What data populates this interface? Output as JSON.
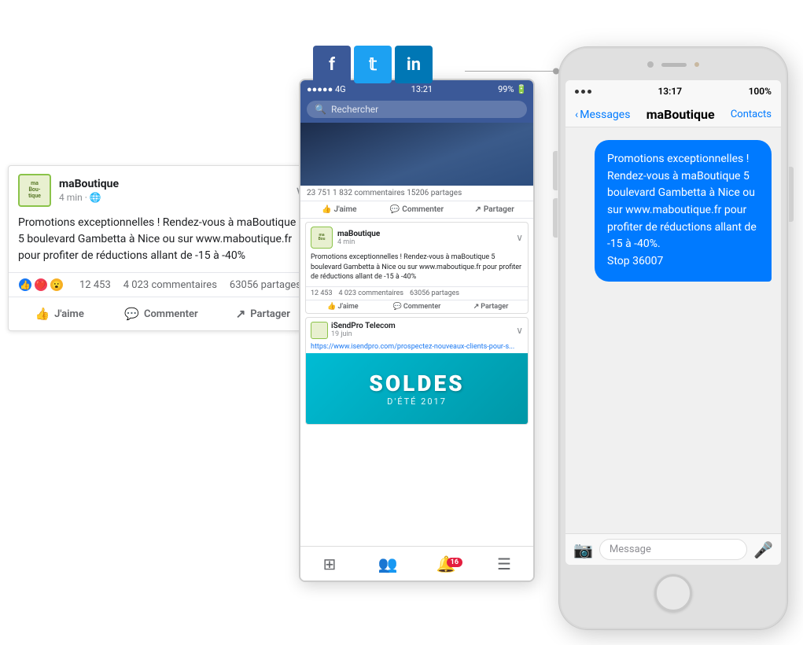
{
  "social": {
    "fb_letter": "f",
    "tw_letter": "t",
    "li_letter": "in"
  },
  "fb_card_left": {
    "brand_name": "maBoutique",
    "brand_lines": [
      "ma",
      "Bou-",
      "tique"
    ],
    "time": "4 min",
    "body": "Promotions exceptionnelles ! Rendez-vous à maBoutique 5 boulevard Gambetta à Nice ou sur www.maboutique.fr pour profiter de réductions allant de -15 à -40%",
    "likes_count": "12 453",
    "comments": "4 023 commentaires",
    "shares": "63056 partages",
    "jaime": "J'aime",
    "commenter": "Commenter",
    "partager": "Partager"
  },
  "phone_fb": {
    "status_left": "●●●●● 4G",
    "status_time": "13:21",
    "status_right": "99%",
    "search_placeholder": "Rechercher",
    "post_stats": "23 751   1 832 commentaires   15206 partages",
    "jaime": "J'aime",
    "commenter": "Commenter",
    "partager": "Partager",
    "mini_brand": "maBoutique",
    "mini_time": "4 min",
    "mini_body": "Promotions exceptionnelles ! Rendez-vous à maBoutique 5 boulevard Gambetta à Nice ou sur www.maboutique.fr pour profiter de réductions allant de -15 à -40%",
    "mini_likes": "12 453",
    "mini_comments": "4 023 commentaires",
    "mini_shares": "63056 partages",
    "soldes_brand": "iSendPro Telecom",
    "soldes_date": "19 juin",
    "soldes_link": "https://www.isendpro.com/prospectez-nouveaux-clients-pour-s...",
    "soldes_title": "SOLDES",
    "soldes_subtitle": "D'ÉTÉ 2017",
    "bottom_badge": "16"
  },
  "phone_sms": {
    "status_time": "13:17",
    "status_battery": "100%",
    "back_label": "Messages",
    "contact_name": "maBoutique",
    "contacts_label": "Contacts",
    "message": "Promotions exceptionnelles ! Rendez-vous à maBoutique 5 boulevard Gambetta à Nice ou sur www.maboutique.fr pour profiter de réductions allant de -15 à -40%.\nStop 36007",
    "input_placeholder": "Message"
  }
}
